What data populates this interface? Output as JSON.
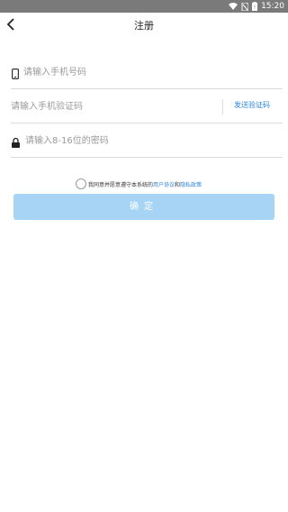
{
  "status_bar": {
    "time": "15:20",
    "icons": [
      "wifi-icon",
      "no-sim-icon",
      "battery-icon"
    ]
  },
  "header": {
    "title": "注册",
    "back_icon": "chevron-left-icon"
  },
  "form": {
    "phone": {
      "placeholder": "请输入手机号码",
      "icon": "phone-icon"
    },
    "code": {
      "placeholder": "请输入手机验证码",
      "send_label": "发送验证码"
    },
    "password": {
      "placeholder": "请输入8-16位的密码",
      "icon": "lock-icon"
    }
  },
  "agreement": {
    "prefix": "我同意并愿意遵守本系统的",
    "user_agreement": "用户协议",
    "conjunction": "和",
    "privacy_policy": "隐私政策",
    "checked": false
  },
  "confirm_button": {
    "label": "确定",
    "color": "#a7d4f5"
  },
  "colors": {
    "accent": "#2e86de",
    "status_bar": "#7a7a7a"
  }
}
